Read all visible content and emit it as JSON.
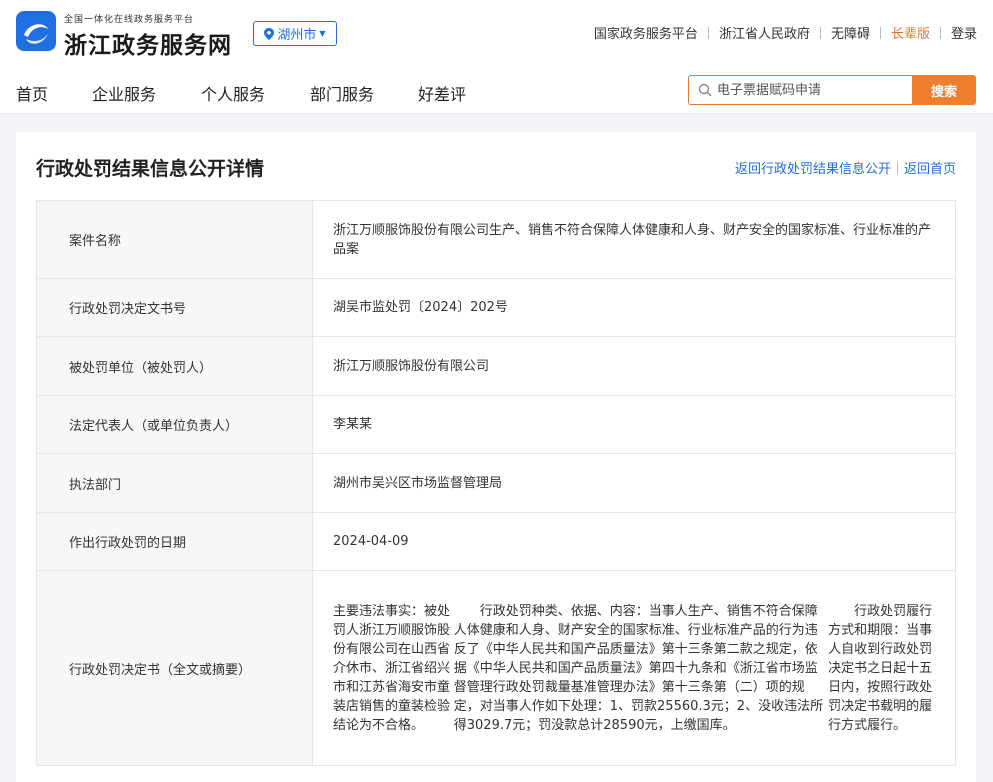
{
  "header": {
    "brand_small": "全国一体化在线政务服务平台",
    "brand_big": "浙江政务服务网",
    "city": "湖州市",
    "links": [
      "国家政务服务平台",
      "浙江省人民政府",
      "无障碍",
      "长辈版",
      "登录"
    ]
  },
  "nav": {
    "items": [
      "首页",
      "企业服务",
      "个人服务",
      "部门服务",
      "好差评"
    ]
  },
  "search": {
    "placeholder": "电子票据赋码申请",
    "button": "搜索"
  },
  "panel": {
    "title": "行政处罚结果信息公开详情",
    "link_back_list": "返回行政处罚结果信息公开",
    "link_back_home": "返回首页"
  },
  "rows": [
    {
      "label": "案件名称",
      "value": "浙江万顺服饰股份有限公司生产、销售不符合保障人体健康和人身、财产安全的国家标准、行业标准的产品案"
    },
    {
      "label": "行政处罚决定文书号",
      "value": "湖吴市监处罚〔2024〕202号"
    },
    {
      "label": "被处罚单位（被处罚人）",
      "value": "浙江万顺服饰股份有限公司"
    },
    {
      "label": "法定代表人（或单位负责人）",
      "value": "李某某"
    },
    {
      "label": "执法部门",
      "value": "湖州市吴兴区市场监督管理局"
    },
    {
      "label": "作出行政处罚的日期",
      "value": "2024-04-09"
    }
  ],
  "summary": {
    "label": "行政处罚决定书（全文或摘要）",
    "p1": "主要违法事实：被处罚人浙江万顺服饰股份有限公司在山西省介休市、浙江省绍兴市和江苏省海安市童装店销售的童装检验结论为不合格。",
    "p2": "行政处罚种类、依据、内容：当事人生产、销售不符合保障人体健康和人身、财产安全的国家标准、行业标准产品的行为违反了《中华人民共和国产品质量法》第十三条第二款之规定，依据《中华人民共和国产品质量法》第四十九条和《浙江省市场监督管理行政处罚裁量基准管理办法》第十三条第（二）项的规定，对当事人作如下处理：1、罚款25560.3元；2、没收违法所得3029.7元；罚没款总计28590元，上缴国库。",
    "p3": "行政处罚履行方式和期限：当事人自收到行政处罚决定书之日起十五日内，按照行政处罚决定书载明的履行方式履行。"
  },
  "colors": {
    "brand_blue": "#1f6fe0",
    "search_orange": "#f07f2d",
    "elder_orange": "#e6762a"
  }
}
